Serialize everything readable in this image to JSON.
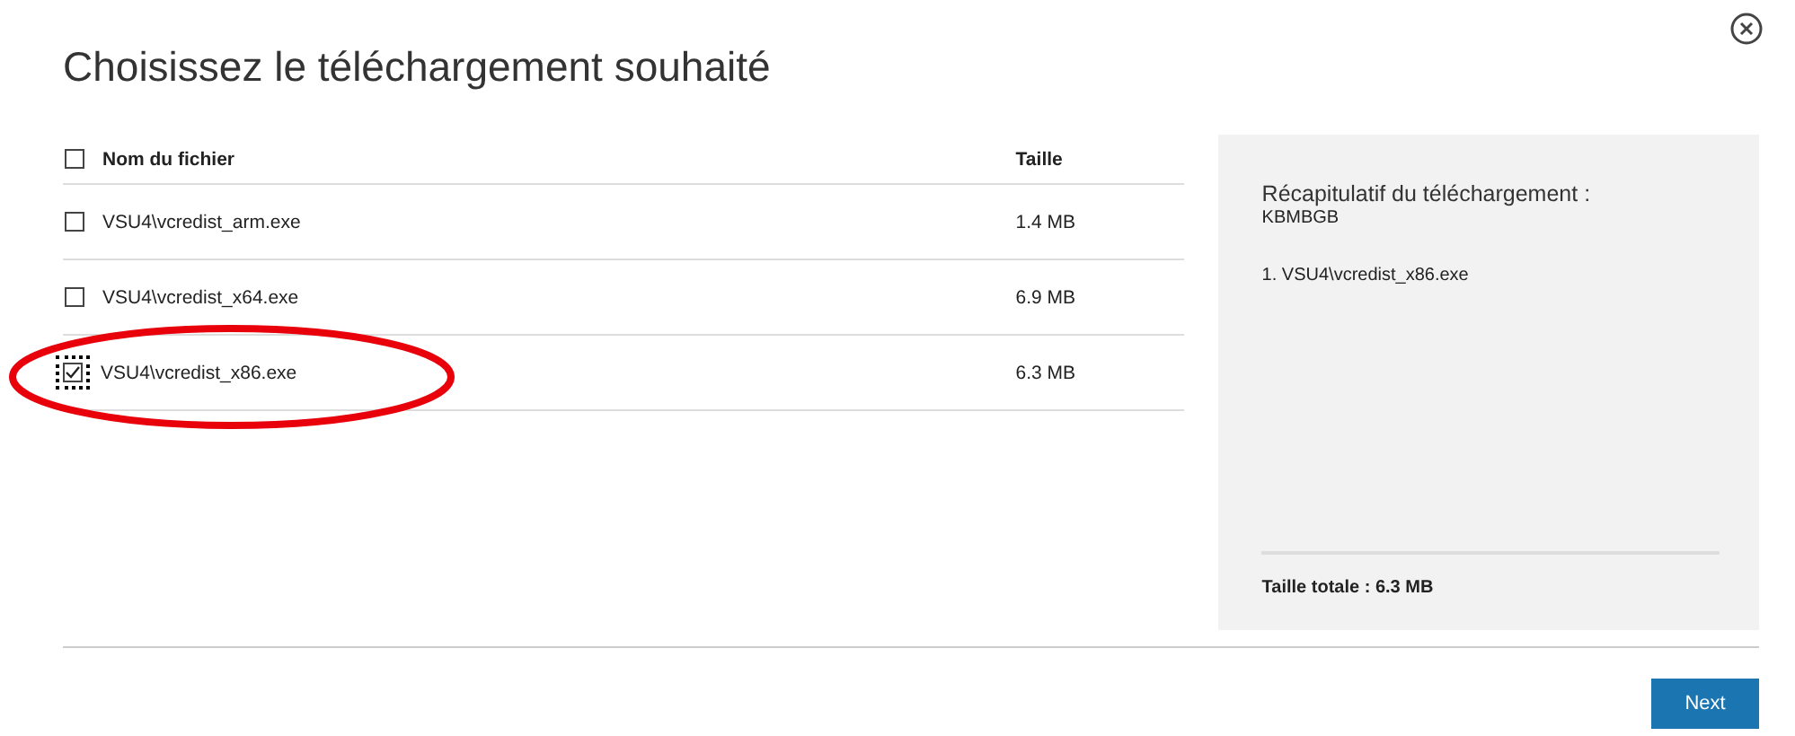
{
  "title": "Choisissez le téléchargement souhaité",
  "table": {
    "select_all_checked": false,
    "columns": [
      "Nom du fichier",
      "Taille"
    ],
    "rows": [
      {
        "name": "VSU4\\vcredist_arm.exe",
        "size": "1.4 MB",
        "checked": false,
        "focused": false,
        "circled": false
      },
      {
        "name": "VSU4\\vcredist_x64.exe",
        "size": "6.9 MB",
        "checked": false,
        "focused": false,
        "circled": false
      },
      {
        "name": "VSU4\\vcredist_x86.exe",
        "size": "6.3 MB",
        "checked": true,
        "focused": true,
        "circled": true
      }
    ]
  },
  "summary": {
    "heading": "Récapitulatif du téléchargement :",
    "code": "KBMBGB",
    "items": [
      "1. VSU4\\vcredist_x86.exe"
    ],
    "total": "Taille totale : 6.3 MB"
  },
  "next_button": "Next"
}
